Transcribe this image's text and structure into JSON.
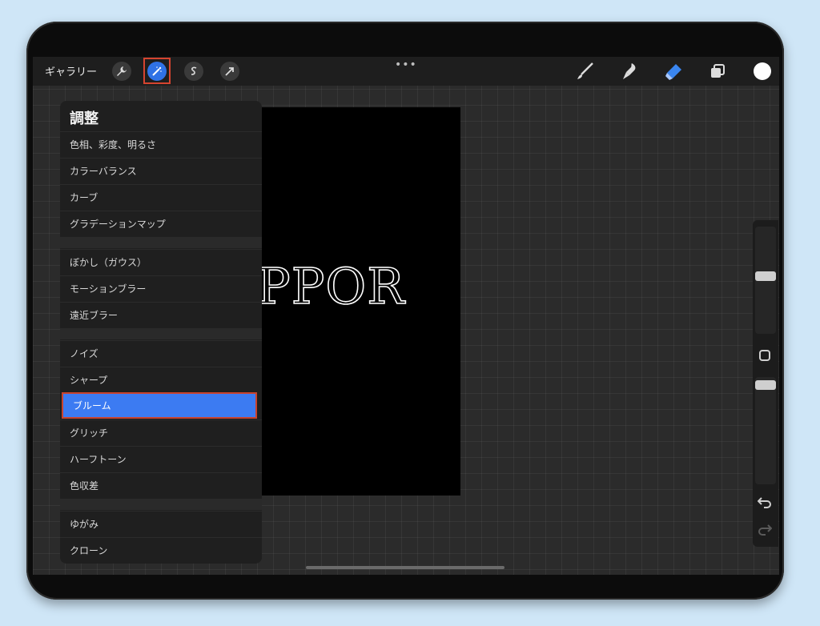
{
  "toolbar": {
    "gallery_label": "ギャラリー",
    "actions_icon": "wrench-icon",
    "adjustments_icon": "magic-wand-icon",
    "selection_icon": "selection-s-icon",
    "transform_icon": "transform-arrow-icon",
    "more_icon": "more-dots-icon",
    "brush_icon": "brush-icon",
    "smudge_icon": "smudge-icon",
    "eraser_icon": "eraser-icon",
    "layers_icon": "layers-icon",
    "accent_color": "#2f72e6",
    "current_color": "#ffffff"
  },
  "canvas": {
    "text": "PPOR"
  },
  "panel": {
    "title": "調整",
    "groups": [
      [
        "色相、彩度、明るさ",
        "カラーバランス",
        "カーブ",
        "グラデーションマップ"
      ],
      [
        "ぼかし（ガウス）",
        "モーションブラー",
        "遠近ブラー"
      ],
      [
        "ノイズ",
        "シャープ",
        "ブルーム",
        "グリッチ",
        "ハーフトーン",
        "色収差"
      ],
      [
        "ゆがみ",
        "クローン"
      ]
    ],
    "selected_item": "ブルーム",
    "selected_color": "#3c7bf2",
    "highlight_color": "#d6442f"
  },
  "sidebar": {
    "brush_size_level": 0.5,
    "opacity_level": 0.8,
    "modify_icon": "square-modify-icon",
    "undo_icon": "undo-icon",
    "redo_icon": "redo-icon"
  }
}
